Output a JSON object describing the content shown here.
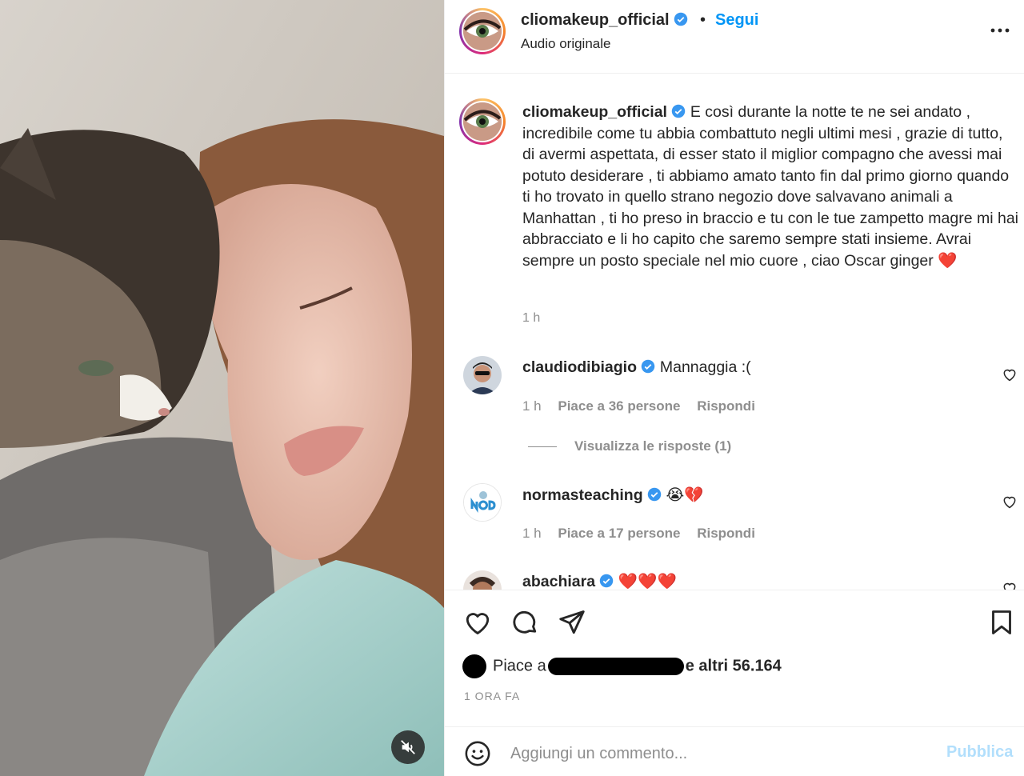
{
  "post": {
    "username": "cliomakeup_official",
    "separator": "•",
    "follow_label": "Segui",
    "audio_label": "Audio originale",
    "more_icon": "more-horizontal-icon",
    "caption": "E così durante la notte te ne sei andato , incredibile come tu abbia combattuto negli ultimi mesi , grazie di tutto, di avermi aspettata, di esser stato il miglior compagno che avessi mai potuto desiderare , ti abbiamo amato tanto fin dal primo giorno quando ti ho trovato in quello strano negozio dove salvavano animali a Manhattan , ti ho preso in braccio e tu con le tue zampetto magre mi hai abbracciato e li ho capito che saremo sempre stati insieme. Avrai sempre un posto speciale nel mio cuore , ciao Oscar ginger ❤️",
    "caption_time": "1 h"
  },
  "comments": [
    {
      "username": "claudiodibiagio",
      "text": "Mannaggia :(",
      "time": "1 h",
      "likes": "Piace a 36 persone",
      "reply": "Rispondi"
    },
    {
      "username": "normasteaching",
      "text": "😭💔",
      "time": "1 h",
      "likes": "Piace a 17 persone",
      "reply": "Rispondi"
    },
    {
      "username": "abachiara",
      "text": "❤️❤️❤️"
    }
  ],
  "view_replies": "Visualizza le risposte (1)",
  "actions": {
    "like_icon": "heart-icon",
    "comment_icon": "comment-icon",
    "share_icon": "send-icon",
    "save_icon": "bookmark-icon"
  },
  "likes": {
    "prefix": "Piace a",
    "suffix": "e altri 56.164"
  },
  "date": "1 ORA FA",
  "composer": {
    "placeholder": "Aggiungi un commento...",
    "post_label": "Pubblica"
  },
  "colors": {
    "link": "#0095f6",
    "muted": "#8e8e8e",
    "text": "#262626",
    "post_disabled": "#b2dffc",
    "verified": "#3897f0"
  }
}
